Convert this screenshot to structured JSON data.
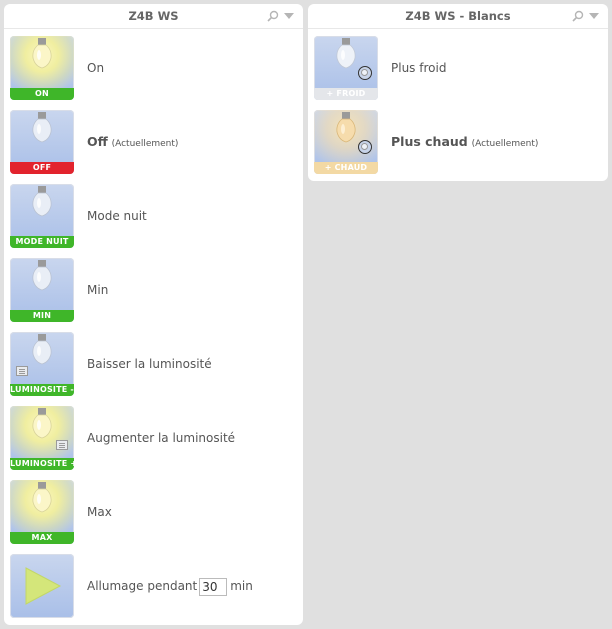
{
  "panels": [
    {
      "title": "Z4B WS",
      "rows": [
        {
          "tile_label": "ON",
          "text": "On",
          "bold": false,
          "state": ""
        },
        {
          "tile_label": "OFF",
          "text": "Off",
          "bold": true,
          "state": "(Actuellement)"
        },
        {
          "tile_label": "MODE NUIT",
          "text": "Mode nuit",
          "bold": false,
          "state": ""
        },
        {
          "tile_label": "MIN",
          "text": "Min",
          "bold": false,
          "state": ""
        },
        {
          "tile_label": "LUMINOSITE -",
          "text": "Baisser la luminosité",
          "bold": false,
          "state": ""
        },
        {
          "tile_label": "LUMINOSITE +",
          "text": "Augmenter la luminosité",
          "bold": false,
          "state": ""
        },
        {
          "tile_label": "MAX",
          "text": "Max",
          "bold": false,
          "state": ""
        },
        {
          "tile_label": "",
          "text": "Allumage pendant",
          "bold": false,
          "state": "",
          "input_value": "30",
          "unit": "min"
        }
      ]
    },
    {
      "title": "Z4B WS - Blancs",
      "rows": [
        {
          "tile_label": "+ FROID",
          "text": "Plus froid",
          "bold": false,
          "state": ""
        },
        {
          "tile_label": "+ CHAUD",
          "text": "Plus chaud",
          "bold": true,
          "state": "(Actuellement)"
        }
      ]
    }
  ],
  "icons": {
    "header": [
      "search-icon",
      "chevron-down-icon"
    ],
    "tiles": [
      "bulb-icon",
      "play-icon",
      "dimmer-icon",
      "knob-icon"
    ]
  },
  "colors": {
    "label_green": "#3fb629",
    "label_red": "#e2232d",
    "label_grey": "#e4e6ea",
    "label_cream": "#f3d9a4",
    "tile_blue": "#a9bfe8",
    "glow_yellow": "#f4f1a0",
    "play_green": "#c8e37a"
  }
}
